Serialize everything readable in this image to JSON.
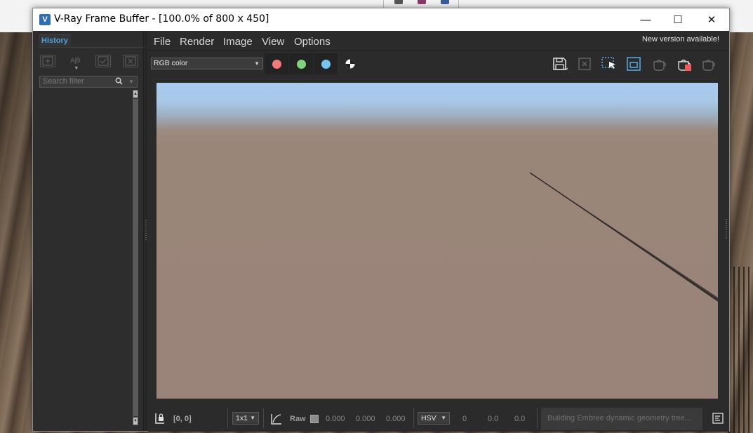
{
  "window": {
    "title": "V-Ray Frame Buffer - [100.0% of 800 x 450]",
    "app_icon_letter": "V",
    "minimize_glyph": "—",
    "maximize_glyph": "☐",
    "close_glyph": "✕"
  },
  "history": {
    "tab_label": "History",
    "search_placeholder": "Search filter",
    "tools": [
      "save-history-icon",
      "compare-ab-icon",
      "load-history-icon",
      "remove-history-icon"
    ],
    "ab_label": "A|B"
  },
  "menu": {
    "items": [
      "File",
      "Render",
      "Image",
      "View",
      "Options"
    ],
    "notice": "New version available!"
  },
  "toolbar": {
    "channel": "RGB color",
    "colors": {
      "red": "#f47a7a",
      "green": "#7ed47e",
      "blue": "#74c6f2"
    }
  },
  "statusbar": {
    "coords": "[0, 0]",
    "sample_size": "1x1",
    "raw_label": "Raw",
    "rgb_values": [
      "0.000",
      "0.000",
      "0.000"
    ],
    "color_space": "HSV",
    "hsv_values": [
      "0",
      "0.0",
      "0.0"
    ],
    "progress_text": "Building Embree dynamic geometry tree..."
  }
}
